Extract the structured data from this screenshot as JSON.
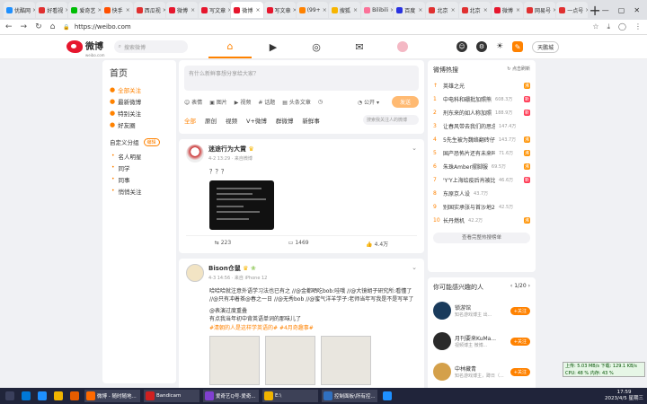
{
  "browser": {
    "tabs": [
      {
        "label": "优酷网",
        "color": "#1e90ff"
      },
      {
        "label": "好看视",
        "color": "#e03030"
      },
      {
        "label": "爱奇艺",
        "color": "#00be06"
      },
      {
        "label": "快手",
        "color": "#ff5000"
      },
      {
        "label": "西瓜视",
        "color": "#e03030"
      },
      {
        "label": "微博",
        "color": "#e6162d"
      },
      {
        "label": "写文章",
        "color": "#e6162d"
      },
      {
        "label": "微博",
        "color": "#e6162d",
        "active": true
      },
      {
        "label": "写文章",
        "color": "#e6162d"
      },
      {
        "label": "(99+",
        "color": "#ff8200"
      },
      {
        "label": "搜狐",
        "color": "#f7b500"
      },
      {
        "label": "Bilibili",
        "color": "#fb7299"
      },
      {
        "label": "百度",
        "color": "#2932e1"
      },
      {
        "label": "北京",
        "color": "#e03030"
      },
      {
        "label": "北京",
        "color": "#e03030"
      },
      {
        "label": "微博",
        "color": "#e6162d"
      },
      {
        "label": "网易号",
        "color": "#e03030"
      },
      {
        "label": "一点号",
        "color": "#e03030"
      }
    ],
    "url": "https://weibo.com"
  },
  "header": {
    "logo": "微博",
    "logo_sub": "weibo.com",
    "search_placeholder": "搜索微博",
    "user": "天鹏城"
  },
  "left": {
    "title": "首页",
    "items": [
      {
        "label": "全部关注",
        "active": true
      },
      {
        "label": "最新微博"
      },
      {
        "label": "特别关注"
      },
      {
        "label": "好友圈"
      }
    ],
    "group_title": "自定义分组",
    "group_tag": "编辑",
    "groups": [
      "名人明星",
      "同学",
      "同事",
      "悄悄关注"
    ]
  },
  "compose": {
    "placeholder": "有什么新鲜事想分享给大家？",
    "tools": [
      "表情",
      "图片",
      "视频",
      "话题",
      "头条文章"
    ],
    "visibility": "公开",
    "publish": "发送"
  },
  "feed_tabs": {
    "items": [
      "全部",
      "原创",
      "视频",
      "V+微博",
      "群微博",
      "新鲜事"
    ],
    "search_placeholder": "搜索我关注人的微博"
  },
  "posts": [
    {
      "user": "迷途行为大賞",
      "meta": "4-2 13:29 · 来自微博",
      "text": "？？？",
      "reposts": "223",
      "comments": "1469",
      "likes": "4.4万"
    },
    {
      "user": "Bison仓鼠",
      "meta": "4-3 14:56 · 来自 iPhone 12",
      "text": "哈哈哈就注意外语学习法也已有之 //@金都晒吃bob:哇哦 //@大镜胡子研究所:看懂了 //@只有冲着茶@春之一日 //@无秀bob //@蜜气洋羊学子:老师当年写我是不是写早了",
      "quote_user": "@表演过度重叠",
      "quote_text": "有点我当年初中背英语单词的那味儿了",
      "hashtag": "#清朝的人是这样学英语的# #4月奇趣事#"
    }
  ],
  "hot": {
    "title": "微博热搜",
    "refresh": "点击刷新",
    "items": [
      {
        "rank": "↑",
        "title": "英雄之光",
        "count": "",
        "badge": "沸",
        "color": "#ff9406"
      },
      {
        "rank": "1",
        "title": "中电科和硼批加照熊",
        "count": "608.3万",
        "badge": "新",
        "color": "#ff3852"
      },
      {
        "rank": "2",
        "title": "刑东来的如人称加照",
        "count": "188.9万",
        "badge": "新",
        "color": "#ff3852"
      },
      {
        "rank": "3",
        "title": "让春风带去我们的思念",
        "count": "147.4万",
        "badge": "",
        "color": ""
      },
      {
        "rank": "4",
        "title": "5先生被为魏络翻砖仔",
        "count": "143.7万",
        "badge": "沸",
        "color": "#ff9406"
      },
      {
        "rank": "5",
        "title": "国产恐怖片还有未来吗",
        "count": "71.6万",
        "badge": "沸",
        "color": "#ff9406"
      },
      {
        "rank": "6",
        "title": "朱珠Amber摆脚服",
        "count": "69.5万",
        "badge": "沸",
        "color": "#ff9406"
      },
      {
        "rank": "7",
        "title": "'Y'Y上海绘疫后肖被比",
        "count": "46.6万",
        "badge": "新",
        "color": "#ff3852"
      },
      {
        "rank": "8",
        "title": "东原京人设",
        "count": "43.7万",
        "badge": "",
        "color": ""
      },
      {
        "rank": "9",
        "title": "别国实承张与首沙地20",
        "count": "42.5万",
        "badge": "",
        "color": ""
      },
      {
        "rank": "10",
        "title": "长丹燃机",
        "count": "42.2万",
        "badge": "沸",
        "color": "#ff9406"
      }
    ],
    "more": "查看完整热搜榜单"
  },
  "recommend": {
    "title": "你可能感兴趣的人",
    "page": "1/20",
    "users": [
      {
        "name": "锁游馆",
        "desc": "知名游戏博主 出...",
        "follow": "+关注",
        "color": "#1a3b5c"
      },
      {
        "name": "月刊要来KuMa...",
        "desc": "视频博主 微博...",
        "follow": "+关注",
        "color": "#2a2a2a"
      },
      {
        "name": "中林藏青",
        "desc": "知名游戏博主，蹲日（...",
        "follow": "+关注",
        "color": "#d4a04a"
      }
    ]
  },
  "netmon": {
    "line1": "上传: 5.03 MB/s  下载: 129.1 KB/s",
    "line2": "CPU: 48 %         内存: 43 %"
  },
  "taskbar": {
    "apps": [
      {
        "label": "",
        "color": "#3a3f5c"
      },
      {
        "label": "",
        "color": "#0078d7"
      },
      {
        "label": "",
        "color": "#1e90ff"
      },
      {
        "label": "",
        "color": "#f0b400"
      },
      {
        "label": "",
        "color": "#e65c00"
      },
      {
        "label": "微博 - 随时随地...",
        "color": "#ff6a00"
      },
      {
        "label": "Bandicam",
        "color": "#d02020"
      },
      {
        "label": "爱奇艺Q号-爱奇...",
        "color": "#8040d0"
      },
      {
        "label": "E:\\",
        "color": "#f0b400"
      },
      {
        "label": "控制面板\\所有控...",
        "color": "#3070c0"
      },
      {
        "label": "",
        "color": "#1e90ff"
      }
    ],
    "time": "17:59",
    "date": "2023/4/5 星期三"
  }
}
